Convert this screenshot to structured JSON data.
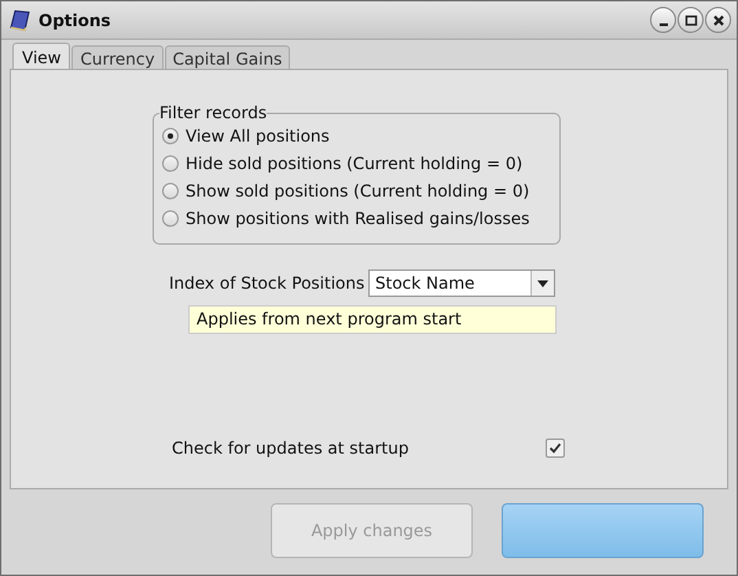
{
  "window": {
    "title": "Options"
  },
  "tabs": [
    {
      "label": "View",
      "selected": true
    },
    {
      "label": "Currency",
      "selected": false
    },
    {
      "label": "Capital Gains",
      "selected": false
    }
  ],
  "filter": {
    "title": "Filter records",
    "options": [
      {
        "label": "View All positions",
        "selected": true
      },
      {
        "label": "Hide sold positions (Current holding = 0)",
        "selected": false
      },
      {
        "label": "Show sold positions (Current holding = 0)",
        "selected": false
      },
      {
        "label": "Show positions with Realised gains/losses",
        "selected": false
      }
    ]
  },
  "index": {
    "label": "Index of Stock Positions",
    "value": "Stock Name",
    "note": "Applies from next program start"
  },
  "updates": {
    "label": "Check for updates at startup",
    "checked": true
  },
  "apply_button": {
    "label": "Apply changes",
    "disabled": true
  }
}
